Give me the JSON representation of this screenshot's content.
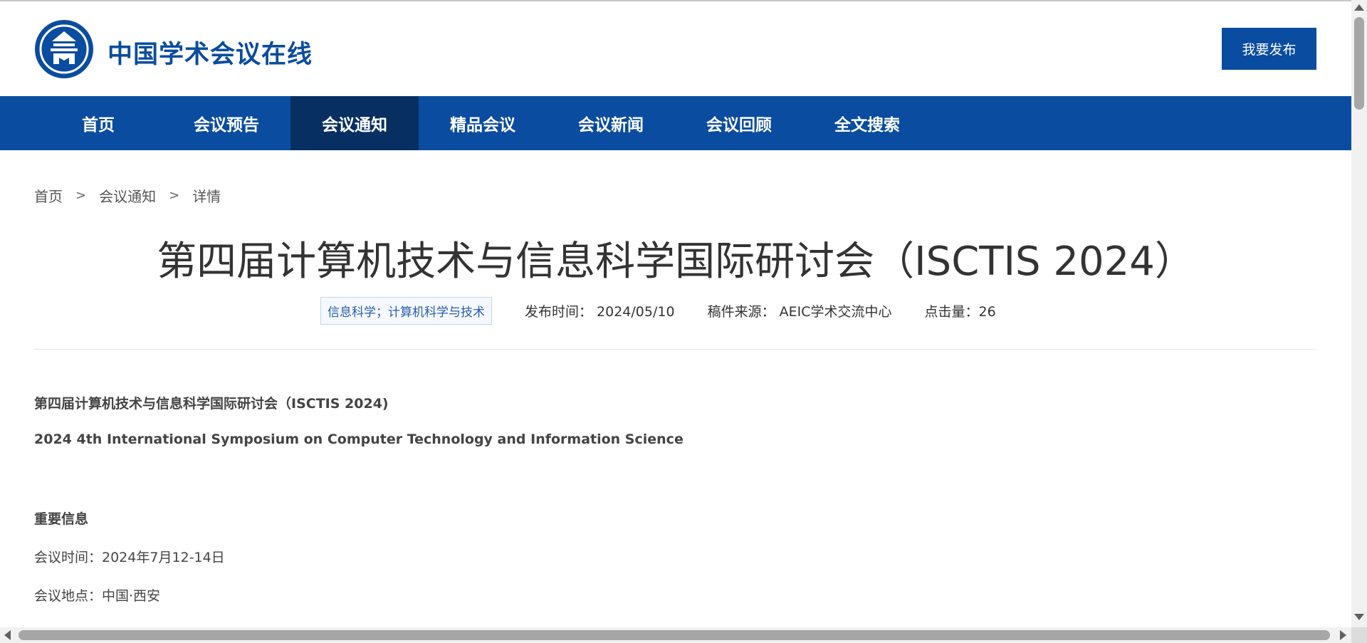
{
  "header": {
    "site_name": "中国学术会议在线",
    "logo_icon": "academy-building-icon",
    "publish_label": "我要发布"
  },
  "nav": {
    "items": [
      {
        "label": "首页",
        "active": false
      },
      {
        "label": "会议预告",
        "active": false
      },
      {
        "label": "会议通知",
        "active": true
      },
      {
        "label": "精品会议",
        "active": false
      },
      {
        "label": "会议新闻",
        "active": false
      },
      {
        "label": "会议回顾",
        "active": false
      },
      {
        "label": "全文搜索",
        "active": false
      }
    ]
  },
  "breadcrumb": {
    "home": "首页",
    "section": "会议通知",
    "current": "详情",
    "separator": ">"
  },
  "article": {
    "title": "第四届计算机技术与信息科学国际研讨会（ISCTIS 2024）",
    "tag": "信息科学；计算机科学与技术",
    "publish_time": "发布时间： 2024/05/10",
    "source": "稿件来源： AEIC学术交流中心",
    "clicks": "点击量：26",
    "body": {
      "title_cn": "第四届计算机技术与信息科学国际研讨会（ISCTIS 2024)",
      "title_en": "2024 4th International Symposium on Computer Technology and Information Science",
      "section_heading": "重要信息",
      "meeting_time": "会议时间：2024年7月12-14日",
      "meeting_place": "会议地点：中国·西安"
    }
  },
  "colors": {
    "brand": "#0a4c9f",
    "nav_active": "#072f62"
  }
}
